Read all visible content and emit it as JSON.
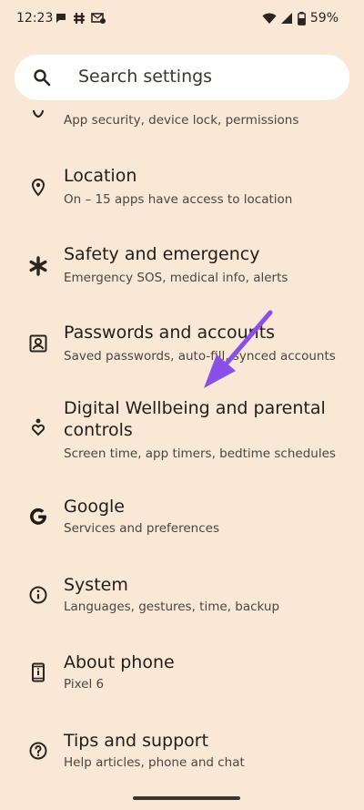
{
  "status": {
    "time": "12:23",
    "battery": "59%"
  },
  "search": {
    "label": "Search settings"
  },
  "items": [
    {
      "title": "",
      "subtitle": "App security, device lock, permissions",
      "icon": "security-icon"
    },
    {
      "title": "Location",
      "subtitle": "On – 15 apps have access to location",
      "icon": "location-pin-icon"
    },
    {
      "title": "Safety and emergency",
      "subtitle": "Emergency SOS, medical info, alerts",
      "icon": "asterisk-icon"
    },
    {
      "title": "Passwords and accounts",
      "subtitle": "Saved passwords, auto-fill, synced accounts",
      "icon": "account-box-icon"
    },
    {
      "title": "Digital Wellbeing and parental",
      "title2": "controls",
      "subtitle": "Screen time, app timers, bedtime schedules",
      "icon": "wellbeing-icon"
    },
    {
      "title": "Google",
      "subtitle": "Services and preferences",
      "icon": "google-icon"
    },
    {
      "title": "System",
      "subtitle": "Languages, gestures, time, backup",
      "icon": "info-icon"
    },
    {
      "title": "About phone",
      "subtitle": "Pixel 6",
      "icon": "phone-icon"
    },
    {
      "title": "Tips and support",
      "subtitle": "Help articles, phone and chat",
      "icon": "help-icon"
    }
  ],
  "colors": {
    "background": "#f9e8d5",
    "arrow": "#8a4fe8"
  }
}
